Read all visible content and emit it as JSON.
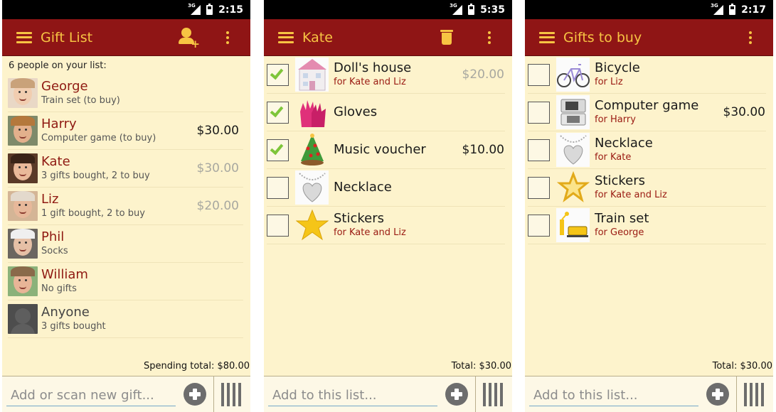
{
  "colors": {
    "appbar": "#8f1515",
    "accent": "#f7c443",
    "background": "#fdf3cc",
    "name_red": "#8f1a12",
    "check_green": "#7ec53a"
  },
  "screens": [
    {
      "status": {
        "time": "2:15",
        "network": "3G"
      },
      "appbar": {
        "title": "Gift List",
        "icons": [
          "menu-icon",
          "add-person-icon",
          "overflow-menu-icon"
        ]
      },
      "header": "6 people on your list:",
      "people": [
        {
          "name": "George",
          "sub": "Train set (to buy)",
          "amount": "",
          "dim": false
        },
        {
          "name": "Harry",
          "sub": "Computer game (to buy)",
          "amount": "$30.00",
          "dim": false
        },
        {
          "name": "Kate",
          "sub": "3 gifts bought, 2 to buy",
          "amount": "$30.00",
          "dim": true
        },
        {
          "name": "Liz",
          "sub": "1 gift bought, 2 to buy",
          "amount": "$20.00",
          "dim": true
        },
        {
          "name": "Phil",
          "sub": "Socks",
          "amount": "",
          "dim": false
        },
        {
          "name": "William",
          "sub": "No gifts",
          "amount": "",
          "dim": false
        },
        {
          "name": "Anyone",
          "sub": "3 gifts bought",
          "amount": "",
          "dim": false
        }
      ],
      "total": "Spending total: $80.00",
      "input_placeholder": "Add or scan new gift..."
    },
    {
      "status": {
        "time": "5:35",
        "network": "3G"
      },
      "appbar": {
        "title": "Kate",
        "icons": [
          "menu-icon",
          "trash-icon",
          "overflow-menu-icon"
        ]
      },
      "gifts": [
        {
          "name": "Doll's house",
          "for": "for Kate and Liz",
          "amount": "$20.00",
          "dim": true,
          "checked": true,
          "thumb": "dollhouse"
        },
        {
          "name": "Gloves",
          "for": "",
          "amount": "",
          "dim": false,
          "checked": true,
          "thumb": "gloves"
        },
        {
          "name": "Music voucher",
          "for": "",
          "amount": "$10.00",
          "dim": false,
          "checked": true,
          "thumb": "tree"
        },
        {
          "name": "Necklace",
          "for": "",
          "amount": "",
          "dim": false,
          "checked": false,
          "thumb": "necklace"
        },
        {
          "name": "Stickers",
          "for": "for Kate and Liz",
          "amount": "",
          "dim": false,
          "checked": false,
          "thumb": "star"
        }
      ],
      "total": "Total: $30.00",
      "input_placeholder": "Add to this list..."
    },
    {
      "status": {
        "time": "2:17",
        "network": "3G"
      },
      "appbar": {
        "title": "Gifts to buy",
        "icons": [
          "menu-icon",
          "overflow-menu-icon"
        ]
      },
      "gifts": [
        {
          "name": "Bicycle",
          "for": "for Liz",
          "amount": "",
          "dim": false,
          "checked": false,
          "thumb": "bicycle"
        },
        {
          "name": "Computer game",
          "for": "for Harry",
          "amount": "$30.00",
          "dim": false,
          "checked": false,
          "thumb": "console"
        },
        {
          "name": "Necklace",
          "for": "for Kate",
          "amount": "",
          "dim": false,
          "checked": false,
          "thumb": "necklace"
        },
        {
          "name": "Stickers",
          "for": "for Kate and Liz",
          "amount": "",
          "dim": false,
          "checked": false,
          "thumb": "star-outline"
        },
        {
          "name": "Train set",
          "for": "for George",
          "amount": "",
          "dim": false,
          "checked": false,
          "thumb": "train"
        }
      ],
      "total": "Total: $30.00",
      "input_placeholder": "Add to this list..."
    }
  ]
}
